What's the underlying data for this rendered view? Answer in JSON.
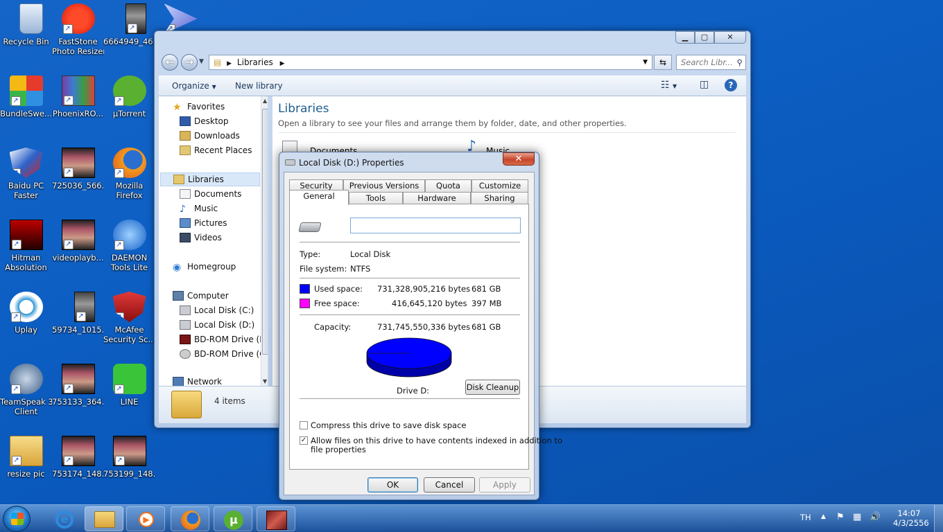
{
  "desktop": {
    "icons": [
      {
        "label": "Recycle Bin",
        "line2": "",
        "icon": "recycle-bin-icon"
      },
      {
        "label": "FastStone",
        "line2": "Photo Resizer",
        "icon": "faststone-icon"
      },
      {
        "label": "6664949_46...",
        "line2": "",
        "icon": "image-file-icon"
      },
      {
        "label": "KMPlayer",
        "line2": "",
        "icon": "kmplayer-icon"
      },
      {
        "label": "BundleSwe...",
        "line2": "",
        "icon": "bundle-icon"
      },
      {
        "label": "PhoenixRO...",
        "line2": "",
        "icon": "winrar-icon"
      },
      {
        "label": "µTorrent",
        "line2": "",
        "icon": "utorrent-icon"
      },
      {
        "label": "Baidu PC",
        "line2": "Faster",
        "icon": "baidu-shield-icon"
      },
      {
        "label": "725036_566...",
        "line2": "",
        "icon": "video-file-icon"
      },
      {
        "label": "Mozilla",
        "line2": "Firefox",
        "icon": "firefox-icon"
      },
      {
        "label": "Hitman",
        "line2": "Absolution",
        "icon": "hitman-icon"
      },
      {
        "label": "videoplayb...",
        "line2": "",
        "icon": "video-file-icon"
      },
      {
        "label": "DAEMON",
        "line2": "Tools Lite",
        "icon": "daemon-tools-icon"
      },
      {
        "label": "Uplay",
        "line2": "",
        "icon": "uplay-icon"
      },
      {
        "label": "59734_1015...",
        "line2": "",
        "icon": "image-file-icon"
      },
      {
        "label": "McAfee",
        "line2": "Security Sc...",
        "icon": "mcafee-icon"
      },
      {
        "label": "TeamSpeak 3",
        "line2": "Client",
        "icon": "teamspeak-icon"
      },
      {
        "label": "753133_364...",
        "line2": "",
        "icon": "video-file-icon"
      },
      {
        "label": "LINE",
        "line2": "",
        "icon": "line-app-icon"
      },
      {
        "label": "resize pic",
        "line2": "",
        "icon": "folder-icon"
      },
      {
        "label": "753174_148...",
        "line2": "",
        "icon": "video-file-icon"
      },
      {
        "label": "753199_148...",
        "line2": "",
        "icon": "video-file-icon"
      }
    ]
  },
  "explorer": {
    "address": "Libraries",
    "search_placeholder": "Search Libr...",
    "organize_label": "Organize",
    "new_library_label": "New library",
    "nav": {
      "favorites": "Favorites",
      "desktop": "Desktop",
      "downloads": "Downloads",
      "recent": "Recent Places",
      "libraries": "Libraries",
      "documents": "Documents",
      "music": "Music",
      "pictures": "Pictures",
      "videos": "Videos",
      "homegroup": "Homegroup",
      "computer": "Computer",
      "disk_c": "Local Disk (C:)",
      "disk_d": "Local Disk (D:)",
      "bd_f": "BD-ROM Drive (F",
      "bd_g": "BD-ROM Drive (G",
      "network": "Network"
    },
    "content": {
      "title": "Libraries",
      "description": "Open a library to see your files and arrange them by folder, date, and other properties.",
      "item_documents": "Documents",
      "item_music": "Music"
    },
    "status_items": "4 items"
  },
  "dialog": {
    "title": "Local Disk (D:) Properties",
    "tabs_top": [
      "Security",
      "Previous Versions",
      "Quota",
      "Customize"
    ],
    "tabs_bottom": [
      "General",
      "Tools",
      "Hardware",
      "Sharing"
    ],
    "name_value": "",
    "type_label": "Type:",
    "type_value": "Local Disk",
    "fs_label": "File system:",
    "fs_value": "NTFS",
    "used_label": "Used space:",
    "used_bytes": "731,328,905,216 bytes",
    "used_size": "681 GB",
    "free_label": "Free space:",
    "free_bytes": "416,645,120 bytes",
    "free_size": "397 MB",
    "capacity_label": "Capacity:",
    "capacity_bytes": "731,745,550,336 bytes",
    "capacity_size": "681 GB",
    "drive_label": "Drive D:",
    "disk_cleanup_label": "Disk Cleanup",
    "compress_label": "Compress this drive to save disk space",
    "compress_checked": false,
    "index_label_1": "Allow files on this drive to have contents indexed in addition to",
    "index_label_2": "file properties",
    "index_checked": true,
    "ok_label": "OK",
    "cancel_label": "Cancel",
    "apply_label": "Apply",
    "colors": {
      "used": "#0000ff",
      "free": "#ff00ff"
    },
    "used_fraction": 0.99943
  },
  "taskbar": {
    "lang": "TH",
    "time": "14:07",
    "date": "4/3/2556",
    "apps": [
      "explorer-icon",
      "media-player-icon",
      "firefox-icon",
      "utorrent-icon",
      "game-icon"
    ],
    "pinned": [
      "ie-icon"
    ]
  }
}
